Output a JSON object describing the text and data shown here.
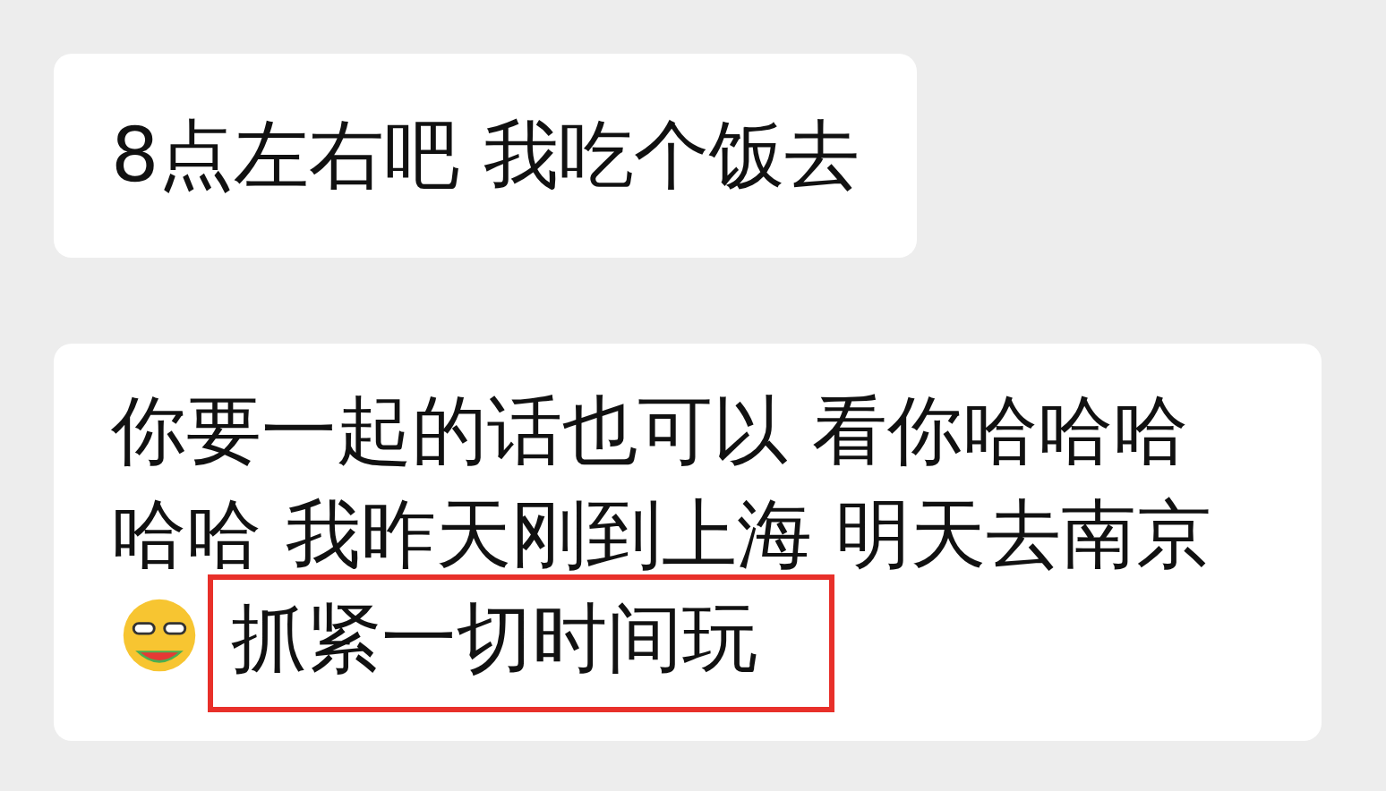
{
  "messages": [
    {
      "segments": [
        {
          "kind": "text",
          "text": "8点左右吧 我吃个饭去"
        }
      ]
    },
    {
      "segments": [
        {
          "kind": "text",
          "text": "你要一起的话也可以 看你哈哈哈哈哈 我昨天刚到上海 明天去南京"
        },
        {
          "kind": "emoji"
        },
        {
          "kind": "highlight",
          "text": "抓紧一切时间玩"
        }
      ]
    }
  ]
}
